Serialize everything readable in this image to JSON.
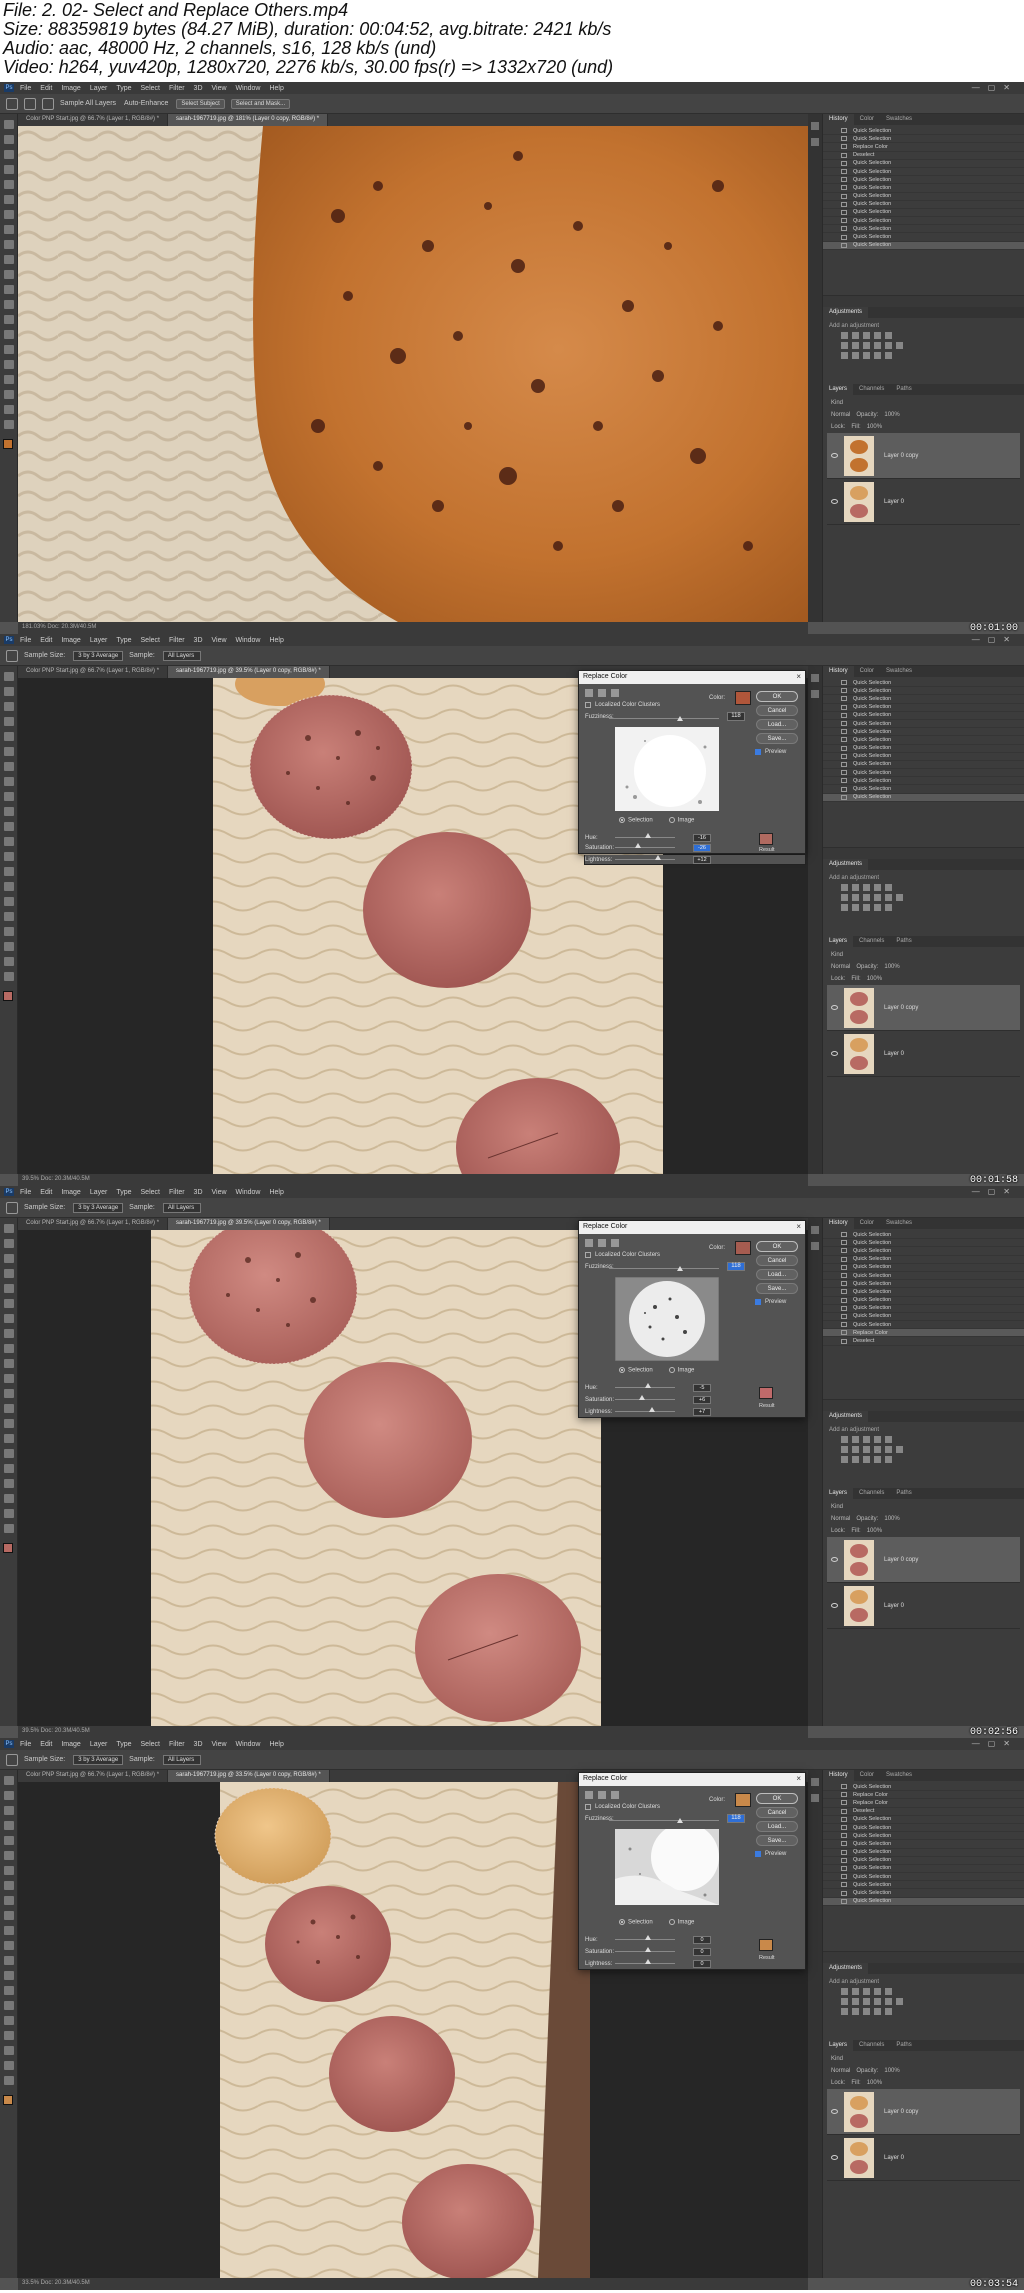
{
  "header": {
    "line1": "File: 2. 02- Select and Replace Others.mp4",
    "line2": "Size: 88359819 bytes (84.27 MiB), duration: 00:04:52, avg.bitrate: 2421 kb/s",
    "line3": "Audio: aac, 48000 Hz, 2 channels, s16, 128 kb/s (und)",
    "line4": "Video: h264, yuv420p, 1280x720, 2276 kb/s, 30.00 fps(r) => 1332x720 (und)"
  },
  "menu": [
    "File",
    "Edit",
    "Image",
    "Layer",
    "Type",
    "Select",
    "Filter",
    "3D",
    "View",
    "Window",
    "Help"
  ],
  "options_bar": {
    "frame1": {
      "sample_all_layers": "Sample All Layers",
      "auto_enhance": "Auto-Enhance",
      "select_subject": "Select Subject",
      "select_and_mask": "Select and Mask..."
    },
    "sample_size_label": "Sample Size:",
    "sample_size_value": "3 by 3 Average",
    "sample_label": "Sample:",
    "sample_value": "All Layers"
  },
  "tabs": {
    "doc1": "Color PNP Start.jpg @ 66.7% (Layer 1, RGB/8#) *",
    "frame1_doc2": "sarah-1967719.jpg @ 181% (Layer 0 copy, RGB/8#) *",
    "frame2_doc2": "sarah-1967719.jpg @ 39.5% (Layer 0 copy, RGB/8#) *",
    "frame3_doc2": "sarah-1967719.jpg @ 39.5% (Layer 0 copy, RGB/8#) *",
    "frame4_doc2": "sarah-1967719.jpg @ 33.5% (Layer 0 copy, RGB/8#) *"
  },
  "status": {
    "frame1": "181.03%    Doc: 20.3M/40.5M",
    "frame2": "39.5%    Doc: 20.3M/40.5M",
    "frame3": "39.5%    Doc: 20.3M/40.5M",
    "frame4": "33.5%    Doc: 20.3M/40.5M"
  },
  "timestamps": [
    "00:01:00",
    "00:01:58",
    "00:02:56",
    "00:03:54"
  ],
  "panels": {
    "history_tabs": [
      "History",
      "Color",
      "Swatches"
    ],
    "adjust_tab": "Adjustments",
    "add_adjustment": "Add an adjustment",
    "layers_tabs": [
      "Layers",
      "Channels",
      "Paths"
    ],
    "kind": "Kind",
    "blend": "Normal",
    "opacity_label": "Opacity:",
    "opacity_value": "100%",
    "lock_label": "Lock:",
    "fill_label": "Fill:",
    "fill_value": "100%",
    "layer_top": "Layer 0 copy",
    "layer_bottom": "Layer 0"
  },
  "history": {
    "frame1": [
      "Quick Selection",
      "Quick Selection",
      "Replace Color",
      "Deselect",
      "Quick Selection",
      "Quick Selection",
      "Quick Selection",
      "Quick Selection",
      "Quick Selection",
      "Quick Selection",
      "Quick Selection",
      "Quick Selection",
      "Quick Selection",
      "Quick Selection",
      "Quick Selection"
    ],
    "frame2": [
      "Quick Selection",
      "Quick Selection",
      "Quick Selection",
      "Quick Selection",
      "Quick Selection",
      "Quick Selection",
      "Quick Selection",
      "Quick Selection",
      "Quick Selection",
      "Quick Selection",
      "Quick Selection",
      "Quick Selection",
      "Quick Selection",
      "Quick Selection",
      "Quick Selection"
    ],
    "frame3": [
      "Quick Selection",
      "Quick Selection",
      "Quick Selection",
      "Quick Selection",
      "Quick Selection",
      "Quick Selection",
      "Quick Selection",
      "Quick Selection",
      "Quick Selection",
      "Quick Selection",
      "Quick Selection",
      "Quick Selection",
      "Replace Color",
      "Deselect"
    ],
    "frame4": [
      "Quick Selection",
      "Replace Color",
      "Replace Color",
      "Deselect",
      "Quick Selection",
      "Quick Selection",
      "Quick Selection",
      "Quick Selection",
      "Quick Selection",
      "Quick Selection",
      "Quick Selection",
      "Quick Selection",
      "Quick Selection",
      "Quick Selection",
      "Quick Selection"
    ]
  },
  "dialog": {
    "title": "Replace Color",
    "close": "×",
    "localized": "Localized Color Clusters",
    "color_label": "Color:",
    "fuzziness_label": "Fuzziness:",
    "ok": "OK",
    "cancel": "Cancel",
    "load": "Load...",
    "save": "Save...",
    "preview": "Preview",
    "selection": "Selection",
    "image": "Image",
    "hue": "Hue:",
    "saturation": "Saturation:",
    "lightness": "Lightness:",
    "result": "Result",
    "frame2": {
      "fuzz": "118",
      "hue": "-16",
      "sat": "-26",
      "light": "+12",
      "color": "#b0563a",
      "result": "#b06a60"
    },
    "frame3": {
      "fuzz": "118",
      "hue": "-5",
      "sat": "+6",
      "light": "+7",
      "color": "#a65c50",
      "result": "#c06a6a"
    },
    "frame4": {
      "fuzz": "118",
      "hue": "0",
      "sat": "0",
      "light": "0",
      "color": "#c9894a",
      "result": "#c9894a"
    }
  },
  "colors": {
    "ps_bg": "#535353",
    "panel": "#3c3c3c",
    "macaron_pink": "#b86a63",
    "macaron_orange": "#c2722f",
    "wood": "#e6d7bf"
  }
}
